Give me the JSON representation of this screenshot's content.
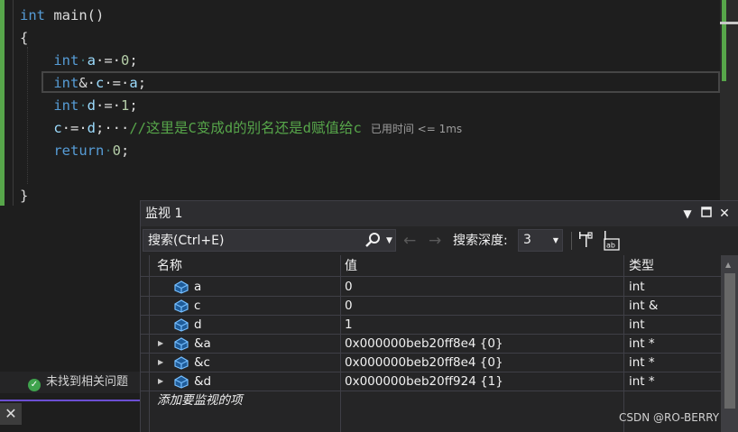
{
  "editor": {
    "lines": [
      {
        "parts": [
          {
            "t": "int",
            "c": "kw"
          },
          {
            "t": " main()",
            "c": "pl"
          }
        ]
      },
      {
        "parts": [
          {
            "t": "{",
            "c": "pl"
          }
        ]
      },
      {
        "parts": [
          {
            "t": "    ",
            "c": "pl"
          },
          {
            "t": "int",
            "c": "kw"
          },
          {
            "t": "·",
            "c": "ws"
          },
          {
            "t": "a",
            "c": "id"
          },
          {
            "t": "·=·",
            "c": "pl"
          },
          {
            "t": "0",
            "c": "num"
          },
          {
            "t": ";",
            "c": "pl"
          }
        ]
      },
      {
        "parts": [
          {
            "t": "    ",
            "c": "pl"
          },
          {
            "t": "int",
            "c": "kw"
          },
          {
            "t": "&·",
            "c": "pl"
          },
          {
            "t": "c",
            "c": "id"
          },
          {
            "t": "·=·",
            "c": "pl"
          },
          {
            "t": "a",
            "c": "id"
          },
          {
            "t": ";",
            "c": "pl"
          }
        ]
      },
      {
        "parts": [
          {
            "t": "    ",
            "c": "pl"
          },
          {
            "t": "int",
            "c": "kw"
          },
          {
            "t": "·",
            "c": "ws"
          },
          {
            "t": "d",
            "c": "id"
          },
          {
            "t": "·=·",
            "c": "pl"
          },
          {
            "t": "1",
            "c": "num"
          },
          {
            "t": ";",
            "c": "pl"
          }
        ]
      },
      {
        "parts": [
          {
            "t": "    ",
            "c": "pl"
          },
          {
            "t": "c",
            "c": "id"
          },
          {
            "t": "·=·",
            "c": "pl"
          },
          {
            "t": "d",
            "c": "id"
          },
          {
            "t": ";···",
            "c": "pl"
          },
          {
            "t": "//这里是C变成d的别名还是d赋值给c",
            "c": "cm"
          },
          {
            "t": "已用时间 <= 1ms",
            "c": "elapsed"
          }
        ]
      },
      {
        "parts": [
          {
            "t": "    ",
            "c": "pl"
          },
          {
            "t": "return",
            "c": "kw"
          },
          {
            "t": "·",
            "c": "ws"
          },
          {
            "t": "0",
            "c": "num"
          },
          {
            "t": ";",
            "c": "pl"
          }
        ]
      },
      {
        "parts": []
      },
      {
        "parts": [
          {
            "t": "}",
            "c": "pl"
          }
        ]
      }
    ]
  },
  "status": {
    "check_label": "未找到相关问题"
  },
  "watch": {
    "title": "监视 1",
    "search_placeholder": "搜索(Ctrl+E)",
    "depth_label": "搜索深度:",
    "depth_value": "3",
    "columns": [
      "名称",
      "值",
      "类型"
    ],
    "rows": [
      {
        "name": "a",
        "value": "0",
        "type": "int",
        "expandable": false
      },
      {
        "name": "c",
        "value": "0",
        "type": "int &",
        "expandable": false
      },
      {
        "name": "d",
        "value": "1",
        "type": "int",
        "expandable": false
      },
      {
        "name": "&a",
        "value": "0x000000beb20ff8e4 {0}",
        "type": "int *",
        "expandable": true
      },
      {
        "name": "&c",
        "value": "0x000000beb20ff8e4 {0}",
        "type": "int *",
        "expandable": true
      },
      {
        "name": "&d",
        "value": "0x000000beb20ff924 {1}",
        "type": "int *",
        "expandable": true
      }
    ],
    "add_item_label": "添加要监视的项"
  },
  "watermark": "CSDN @RO-BERRY",
  "colors": {
    "keyword": "#569cd6",
    "identifier": "#9cdcfe",
    "number": "#b5cea8",
    "comment": "#57a64a",
    "accent": "#6c4fd3"
  },
  "icons": [
    "search-icon",
    "dropdown-icon",
    "back-arrow-icon",
    "forward-arrow-icon",
    "pin-icon",
    "hex-display-icon",
    "variable-icon",
    "expand-icon",
    "close-icon",
    "check-icon"
  ]
}
